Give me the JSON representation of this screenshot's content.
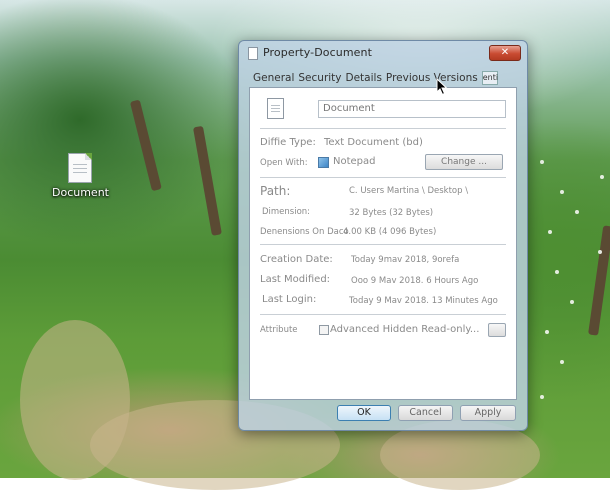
{
  "desktop": {
    "icon_label": "Document"
  },
  "window": {
    "title": "Property-Document",
    "close_glyph": "✕",
    "tabs": [
      "General",
      "Security",
      "Details",
      "Previous Versions"
    ],
    "tab_overflow": "enti"
  },
  "general": {
    "file_name": "Document",
    "file_type_label": "Diffie Type:",
    "file_type_value": "Text Document (bd)",
    "opens_with_label": "Open With:",
    "opens_with_value": "Notepad",
    "change_button": "Change ...",
    "path_label": "Path:",
    "path_value": "C. Users Martina \\ Desktop \\",
    "dimension_label": "Dimension:",
    "dimension_value": "32 Bytes (32 Bytes)",
    "disk_label": "Denensions On Daco",
    "disk_value": "4.00 KB (4 096 Bytes)",
    "created_label": "Creation Date:",
    "created_value": "Today 9mav 2018, 9orefa",
    "modified_label": "Last Modified:",
    "modified_value": "Ooo 9 Mav 2018. 6 Hours Ago",
    "accessed_label": "Last Login:",
    "accessed_value": "Today 9 Mav 2018. 13 Minutes Ago",
    "attribute_label": "Attribute",
    "attribute_value": "Advanced Hidden Read-only..."
  },
  "footer": {
    "ok": "OK",
    "cancel": "Cancel",
    "apply": "Apply"
  },
  "icons": {
    "window_icon": "document-icon",
    "desktop_icon": "document-icon",
    "notepad": "notepad-icon",
    "cursor": "mouse-pointer-icon"
  },
  "colors": {
    "title_bar": "#bed2e4",
    "close_button": "#c94b32",
    "ok_border": "#3c7fb1"
  }
}
